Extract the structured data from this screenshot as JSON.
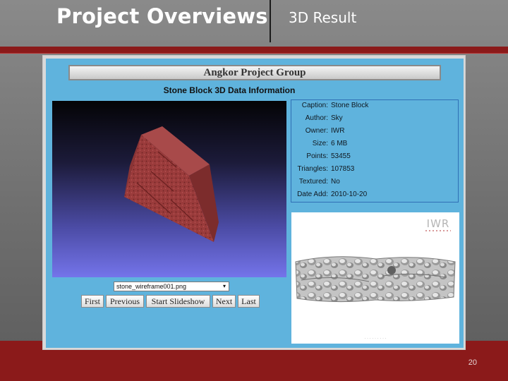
{
  "slide": {
    "title": "Project Overviews",
    "subtitle": "3D Result",
    "page_number": "20"
  },
  "app": {
    "group_title": "Angkor Project Group",
    "data_title": "Stone Block 3D Data Information",
    "info": [
      {
        "label": "Caption:",
        "value": "Stone Block"
      },
      {
        "label": "Author:",
        "value": "Sky"
      },
      {
        "label": "Owner:",
        "value": "IWR"
      },
      {
        "label": "Size:",
        "value": "6 MB"
      },
      {
        "label": "Points:",
        "value": "53455"
      },
      {
        "label": "Triangles:",
        "value": "107853"
      },
      {
        "label": "Textured:",
        "value": "No"
      },
      {
        "label": "Date Add:",
        "value": "2010-10-20"
      }
    ],
    "file_select": {
      "value": "stone_wireframe001.png",
      "arrow": "▾"
    },
    "nav": {
      "first": "First",
      "previous": "Previous",
      "slideshow": "Start Slideshow",
      "next": "Next",
      "last": "Last"
    },
    "thumbnail": {
      "logo": "IWR"
    }
  },
  "colors": {
    "accent_bar": "#8b1a1a",
    "app_background": "#5fb3dd",
    "panel_border": "#2f6fb5"
  }
}
